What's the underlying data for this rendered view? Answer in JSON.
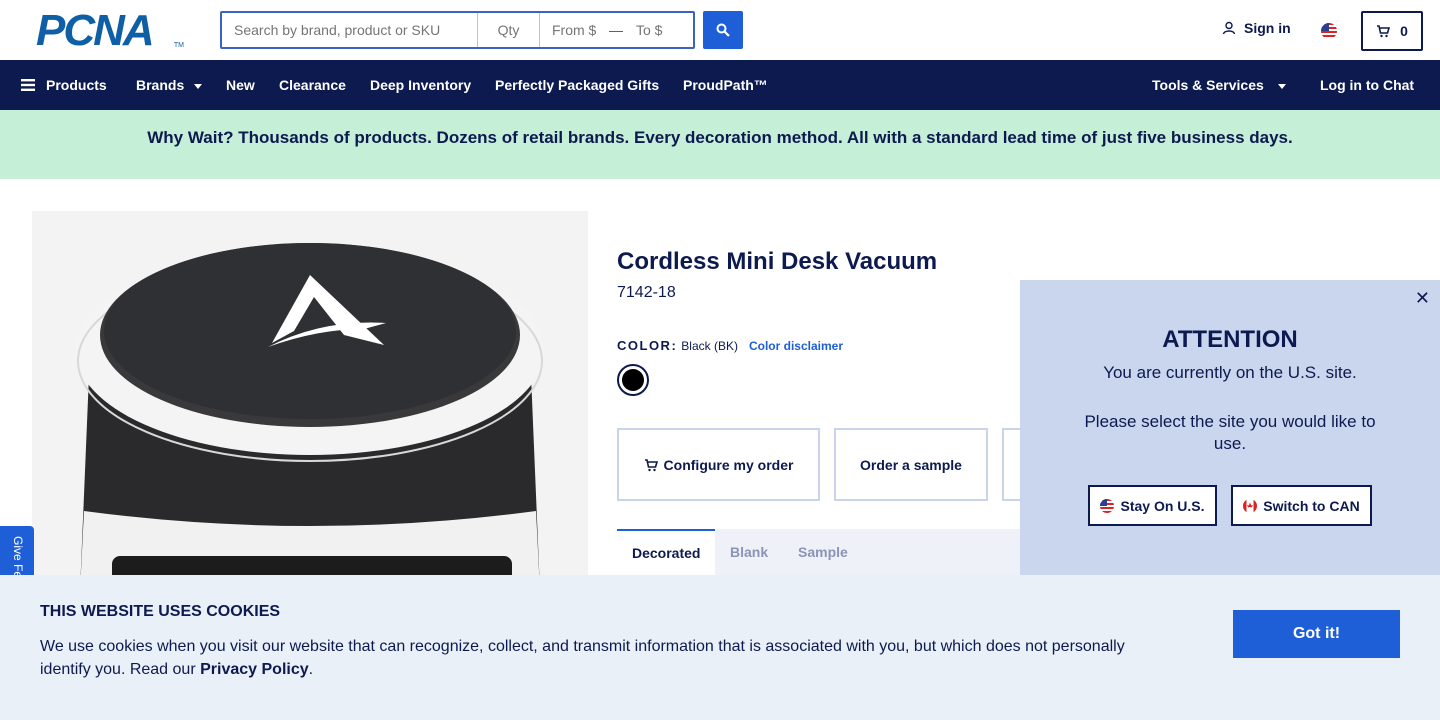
{
  "header": {
    "logo_text": "PCNA",
    "logo_tm": "TM",
    "search_placeholder": "Search by brand, product or SKU",
    "qty_placeholder": "Qty",
    "from_placeholder": "From $",
    "range_dash": "—",
    "to_placeholder": "To $",
    "sign_in": "Sign in",
    "cart_count": "0"
  },
  "nav": {
    "products": "Products",
    "brands": "Brands",
    "new": "New",
    "clearance": "Clearance",
    "deep_inventory": "Deep Inventory",
    "gifts": "Perfectly Packaged Gifts",
    "proudpath": "ProudPath™",
    "tools": "Tools & Services",
    "chat": "Log in to Chat"
  },
  "banner": {
    "text": "Why Wait? Thousands of products. Dozens of retail brands. Every decoration method. All with a standard lead time of just five business days."
  },
  "product": {
    "title": "Cordless Mini Desk Vacuum",
    "sku": "7142-18",
    "color_label": "COLOR:",
    "color_value": "Black (BK)",
    "color_disclaimer": "Color disclaimer",
    "swatch_color": "#000000",
    "configure_button": "Configure my order",
    "sample_button": "Order a sample",
    "tabs": [
      "Decorated",
      "Blank",
      "Sample"
    ]
  },
  "feedback": {
    "label": "Give Feedback"
  },
  "attention": {
    "title": "ATTENTION",
    "line1": "You are currently on the U.S. site.",
    "line2": "Please select the site you would like to use.",
    "stay_button": "Stay On U.S.",
    "switch_button": "Switch to CAN",
    "close": "✕"
  },
  "cookie": {
    "title": "THIS WEBSITE USES COOKIES",
    "text": "We use cookies when you visit our website that can recognize, collect, and transmit information that is associated with you, but which does not personally identify you. Read our",
    "link": "Privacy Policy",
    "period": ".",
    "button": "Got it!"
  },
  "colors": {
    "navy": "#0d1a4f",
    "blue": "#1e5fd8",
    "banner_green": "#c6efd8",
    "popup_bg": "#c9d6ee",
    "cookie_bg": "#eaf0f8"
  }
}
